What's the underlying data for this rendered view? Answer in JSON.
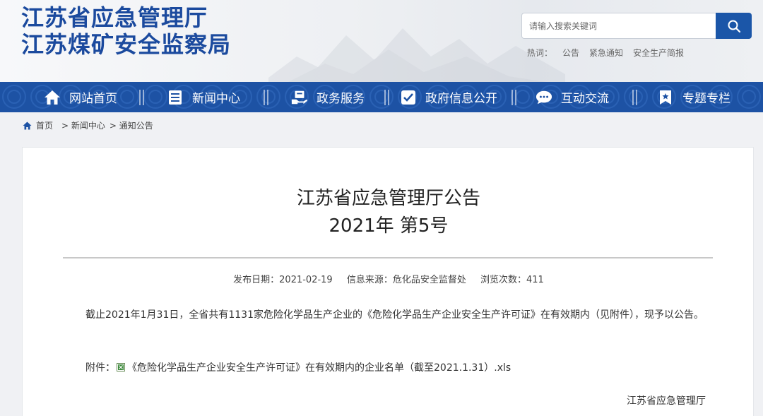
{
  "header": {
    "logo_line1": "江苏省应急管理厅",
    "logo_line2": "江苏煤矿安全监察局",
    "search_placeholder": "请输入搜索关键词",
    "hot_label": "热词：",
    "hot_words": [
      "公告",
      "紧急通知",
      "安全生产简报"
    ]
  },
  "nav": {
    "items": [
      {
        "label": "网站首页",
        "icon": "home-icon"
      },
      {
        "label": "新闻中心",
        "icon": "news-icon"
      },
      {
        "label": "政务服务",
        "icon": "service-icon"
      },
      {
        "label": "政府信息公开",
        "icon": "info-disclosure-icon"
      },
      {
        "label": "互动交流",
        "icon": "chat-icon"
      },
      {
        "label": "专题专栏",
        "icon": "bookmark-icon"
      }
    ]
  },
  "breadcrumb": {
    "home": "首页",
    "level1": "> 新闻中心",
    "level2": "> 通知公告"
  },
  "article": {
    "title_line1": "江苏省应急管理厅公告",
    "title_line2": "2021年 第5号",
    "publish_date": "发布日期：2021-02-19",
    "source": "信息来源：危化品安全监督处",
    "views": "浏览次数：411",
    "body": "截止2021年1月31日，全省共有1131家危险化学品生产企业的《危险化学品生产企业安全生产许可证》在有效期内（见附件），现予以公告。",
    "attachment_label": "附件：",
    "attachment_name": "《危险化学品生产企业安全生产许可证》在有效期内的企业名单（截至2021.1.31）.xls",
    "signature": "江苏省应急管理厅"
  },
  "colors": {
    "brand_blue": "#1b4a9e",
    "nav_blue": "#1d52a4",
    "search_button": "#1b56a8"
  }
}
